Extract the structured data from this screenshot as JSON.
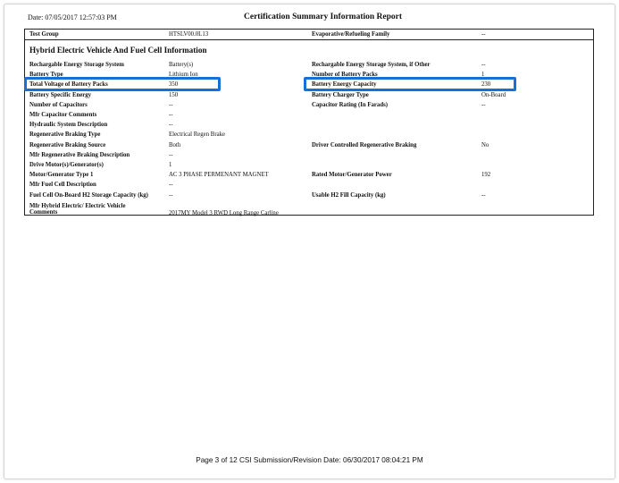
{
  "header": {
    "date": "Date: 07/05/2017 12:57:03 PM",
    "title": "Certification Summary Information Report"
  },
  "top_row": {
    "label1": "Test Group",
    "value1": "HTSLV00.0L13",
    "label2": "Evaporative/Refueling Family",
    "value2": "--"
  },
  "section_title": "Hybrid Electric Vehicle And Fuel Cell Information",
  "rows": [
    {
      "l1": "Rechargable Energy Storage System",
      "v1": "Battery(s)",
      "l2": "Rechargable Energy Storage System, if Other",
      "v2": "--"
    },
    {
      "l1": "Battery Type",
      "v1": "Lithium Ion",
      "l2": "Number of Battery Packs",
      "v2": "1"
    },
    {
      "l1": "Total Voltage of Battery Packs",
      "v1": "350",
      "l2": "Battery Energy Capacity",
      "v2": "230"
    },
    {
      "l1": "Battery Specific Energy",
      "v1": "150",
      "l2": "Battery Charger Type",
      "v2": "On-Board"
    },
    {
      "l1": "Number of Capacitors",
      "v1": "--",
      "l2": "Capacitor Rating (In Farads)",
      "v2": "--"
    },
    {
      "l1": "Mfr Capacitor Comments",
      "v1": "--",
      "l2": "",
      "v2": ""
    },
    {
      "l1": "Hydraulic System Description",
      "v1": "--",
      "l2": "",
      "v2": ""
    },
    {
      "l1": "Regenerative Braking Type",
      "v1": "Electrical Regen Brake",
      "l2": "",
      "v2": ""
    },
    {
      "l1": "Regenerative Braking Source",
      "v1": "Both",
      "l2": "Driver Controlled Regenerative Braking",
      "v2": "No"
    },
    {
      "l1": "Mfr Regenerative Braking Description",
      "v1": "--",
      "l2": "",
      "v2": ""
    },
    {
      "l1": "Drive Motor(s)/Generator(s)",
      "v1": "1",
      "l2": "",
      "v2": ""
    },
    {
      "l1": "Motor/Generator Type 1",
      "v1": "AC 3 PHASE PERMENANT MAGNET",
      "l2": "Rated Motor/Generator Power",
      "v2": "192"
    },
    {
      "l1": "Mfr Fuel Cell Description",
      "v1": "--",
      "l2": "",
      "v2": ""
    },
    {
      "l1": "Fuel Cell On-Board H2 Storage Capacity (kg)",
      "v1": "--",
      "l2": "Usable H2 Fill Capacity (kg)",
      "v2": "--"
    }
  ],
  "comments": {
    "label_line1": "Mfr Hybrid Electric/ Electric Vehicle",
    "label_line2": "Comments",
    "value": "2017MY Model 3 RWD Long Range Carline"
  },
  "footer": "Page 3 of 12   CSI Submission/Revision Date: 06/30/2017 08:04:21 PM",
  "highlight_color": "#1a6fd6"
}
